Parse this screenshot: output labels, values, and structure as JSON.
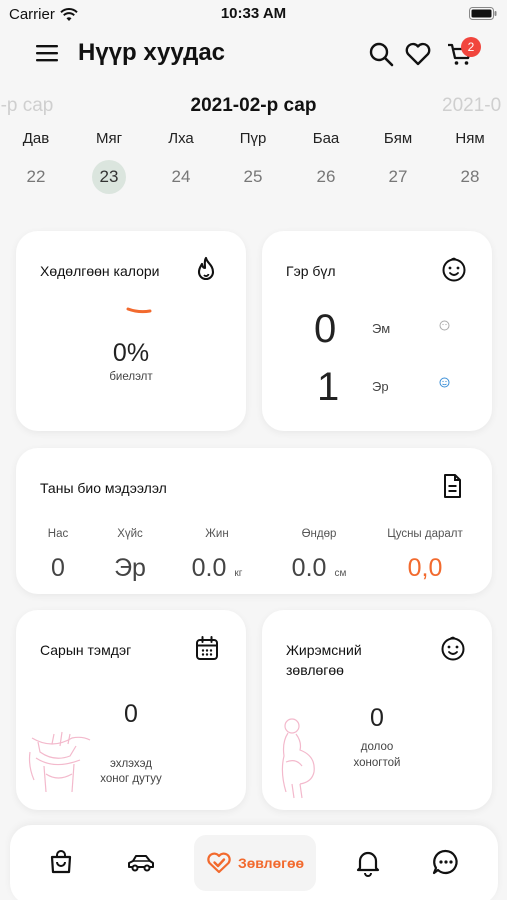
{
  "status": {
    "carrier": "Carrier",
    "time": "10:33 AM"
  },
  "header": {
    "title": "Нүүр хуудас",
    "cart_count": "2"
  },
  "months": {
    "prev": "2-р сар",
    "current": "2021-02-р сар",
    "next": "2021-0"
  },
  "week": [
    {
      "name": "Дав",
      "date": "22"
    },
    {
      "name": "Мяг",
      "date": "23"
    },
    {
      "name": "Лха",
      "date": "24"
    },
    {
      "name": "Пүр",
      "date": "25"
    },
    {
      "name": "Баа",
      "date": "26"
    },
    {
      "name": "Бям",
      "date": "27"
    },
    {
      "name": "Ням",
      "date": "28"
    }
  ],
  "calorie": {
    "title": "Хөдөлгөөн калори",
    "percent": "0%",
    "label": "биелэлт"
  },
  "family": {
    "title": "Гэр бүл",
    "female_count": "0",
    "female_label": "Эм",
    "male_count": "1",
    "male_label": "Эр"
  },
  "bio": {
    "title": "Таны био мэдээлэл",
    "age_label": "Нас",
    "age": "0",
    "sex_label": "Хүйс",
    "sex": "Эр",
    "weight_label": "Жин",
    "weight": "0.0",
    "weight_unit": "кг",
    "height_label": "Өндөр",
    "height": "0.0",
    "height_unit": "см",
    "bp_label": "Цусны даралт",
    "bp": "0,0"
  },
  "period": {
    "title": "Сарын тэмдэг",
    "value": "0",
    "label1": "эхлэхэд",
    "label2": "хоног дутуу"
  },
  "pregnancy": {
    "title_line1": "Жирэмсний",
    "title_line2": "зөвлөгөө",
    "value": "0",
    "label1": "долоо",
    "label2": "хоногтой"
  },
  "nav": {
    "active_label": "Зөвлөгөө"
  },
  "colors": {
    "accent": "#f26a2e",
    "badge": "#f1453d",
    "selected_day": "#dbe5de"
  }
}
